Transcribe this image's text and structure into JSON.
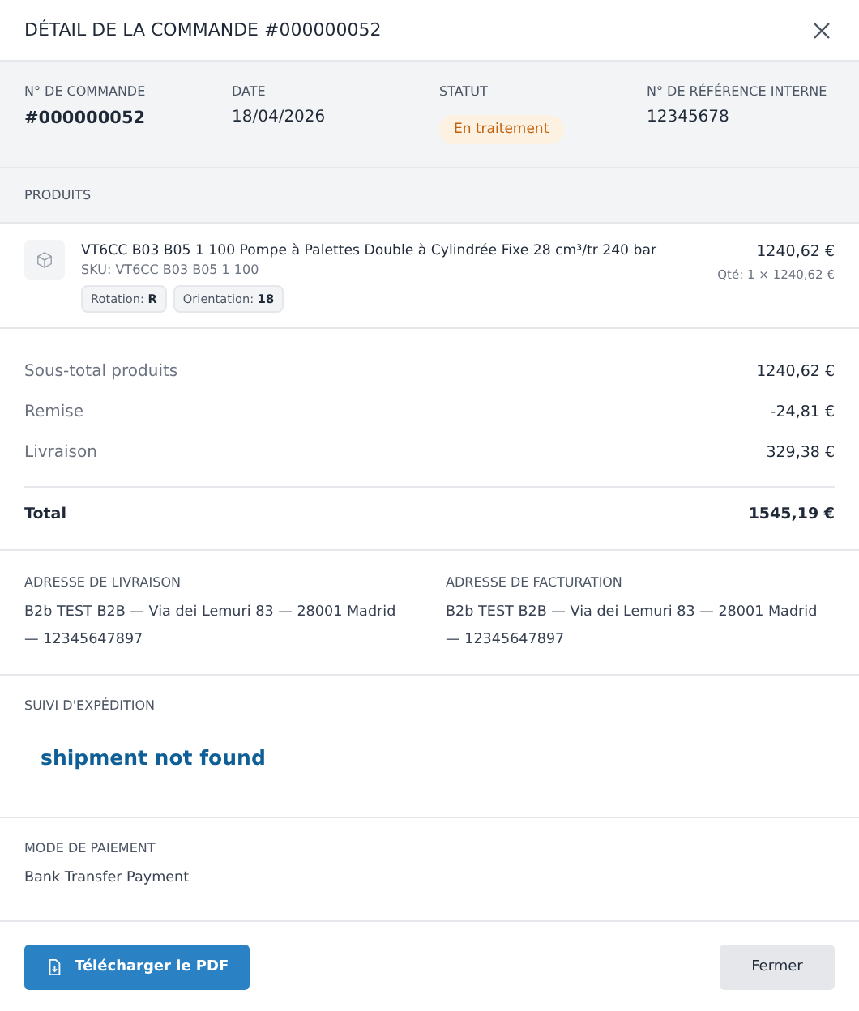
{
  "dialog": {
    "title": "DÉTAIL DE LA COMMANDE #000000052"
  },
  "summary": [
    {
      "label": "N° DE COMMANDE",
      "value": "#000000052",
      "kind": "strong"
    },
    {
      "label": "DATE",
      "value": "18/04/2026",
      "kind": "text"
    },
    {
      "label": "STATUT",
      "value": "En traitement",
      "kind": "badge"
    },
    {
      "label": "N° DE RÉFÉRENCE INTERNE",
      "value": "12345678",
      "kind": "text"
    }
  ],
  "products": {
    "heading": "PRODUITS",
    "items": [
      {
        "name": "VT6CC B03 B05 1 100 Pompe à Palettes Double à Cylindrée Fixe 28 cm³/tr 240 bar",
        "sku": "SKU: VT6CC B03 B05 1 100",
        "price": "1240,62 €",
        "quantity": "Qté: 1 × 1240,62 €",
        "attributes": [
          {
            "label": "Rotation:",
            "value": "R"
          },
          {
            "label": "Orientation:",
            "value": "18"
          }
        ]
      }
    ]
  },
  "totals": [
    {
      "label": "Sous-total produits",
      "value": "1240,62 €",
      "kind": "line"
    },
    {
      "label": "Remise",
      "value": "-24,81 €",
      "kind": "line"
    },
    {
      "label": "Livraison",
      "value": "329,38 €",
      "kind": "line"
    },
    {
      "label": "Total",
      "value": "1545,19 €",
      "kind": "total"
    }
  ],
  "addresses": [
    {
      "heading": "ADRESSE DE LIVRAISON",
      "text": "B2b TEST B2B — Via dei Lemuri 83 — 28001 Madrid — 12345647897"
    },
    {
      "heading": "ADRESSE DE FACTURATION",
      "text": "B2b TEST B2B — Via dei Lemuri 83 — 28001 Madrid — 12345647897"
    }
  ],
  "tracking": {
    "heading": "SUIVI D'EXPÉDITION",
    "message": "shipment not found"
  },
  "payment": {
    "heading": "MODE DE PAIEMENT",
    "method": "Bank Transfer Payment"
  },
  "buttons": [
    {
      "label": "Télécharger le PDF",
      "kind": "primary"
    },
    {
      "label": "Fermer",
      "kind": "secondary"
    }
  ]
}
